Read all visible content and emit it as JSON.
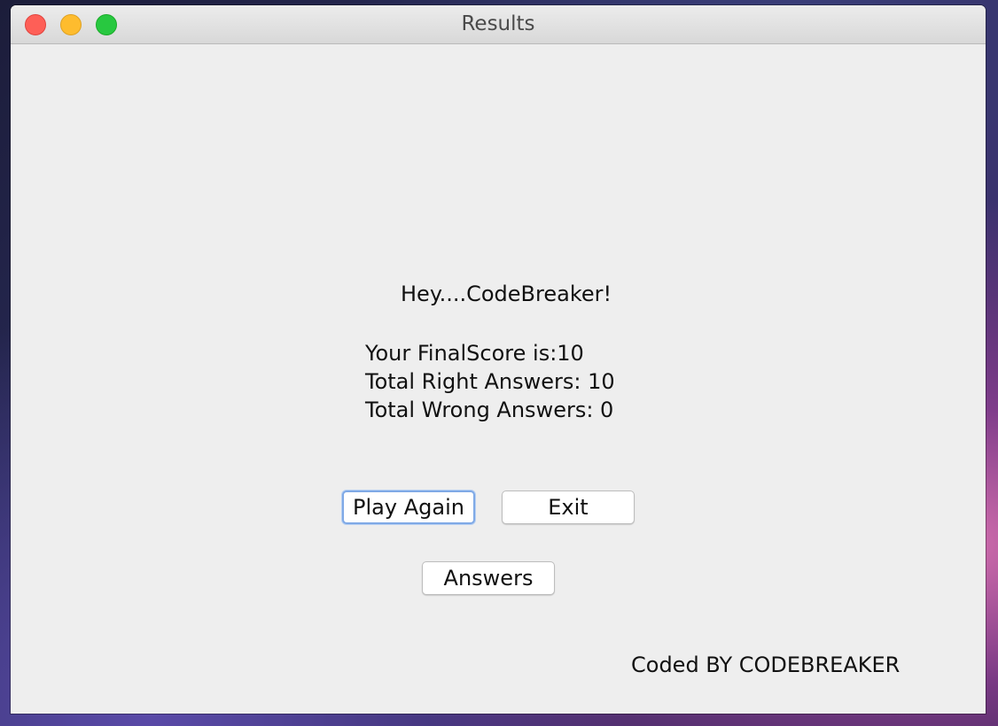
{
  "window": {
    "title": "Results"
  },
  "results": {
    "greeting": "Hey....CodeBreaker!",
    "final_score": "Your FinalScore is:10",
    "right_answers": "Total Right Answers: 10",
    "wrong_answers": "Total Wrong Answers: 0"
  },
  "buttons": {
    "play_again": "Play Again",
    "exit": "Exit",
    "answers": "Answers"
  },
  "footer": {
    "credit": "Coded BY CODEBREAKER"
  },
  "colors": {
    "close": "#fe5f57",
    "minimize": "#febc2e",
    "zoom": "#28c840",
    "focus_ring": "#7fa9e6"
  }
}
